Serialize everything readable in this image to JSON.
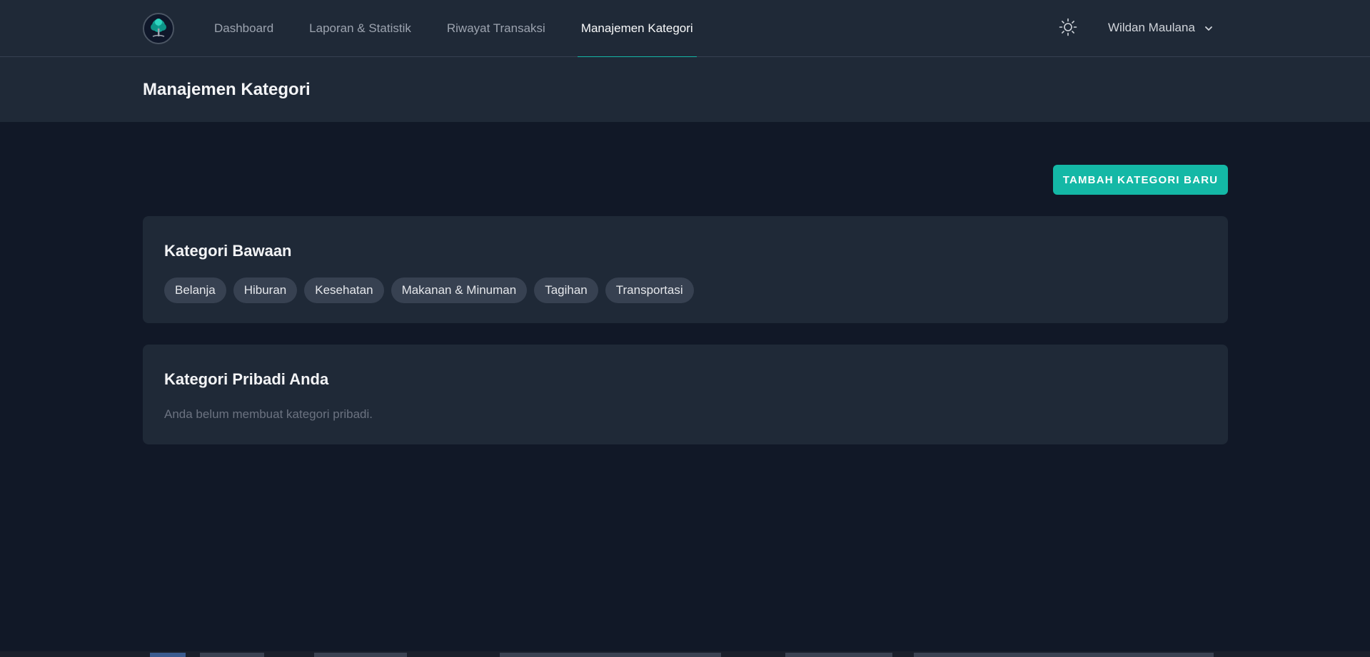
{
  "nav": {
    "links": [
      {
        "label": "Dashboard",
        "active": false
      },
      {
        "label": "Laporan & Statistik",
        "active": false
      },
      {
        "label": "Riwayat Transaksi",
        "active": false
      },
      {
        "label": "Manajemen Kategori",
        "active": true
      }
    ],
    "user_name": "Wildan Maulana"
  },
  "header": {
    "title": "Manajemen Kategori"
  },
  "main": {
    "add_button_label": "TAMBAH KATEGORI BARU",
    "default_card": {
      "title": "Kategori Bawaan",
      "categories": [
        "Belanja",
        "Hiburan",
        "Kesehatan",
        "Makanan & Minuman",
        "Tagihan",
        "Transportasi"
      ]
    },
    "personal_card": {
      "title": "Kategori Pribadi Anda",
      "empty_text": "Anda belum membuat kategori pribadi."
    }
  },
  "icons": {
    "logo": "tree-logo-icon",
    "theme": "sun-icon",
    "user_dropdown": "chevron-down-icon"
  },
  "colors": {
    "accent": "#14b8a6",
    "background": "#111827",
    "surface": "#1f2937",
    "pill": "#374151"
  }
}
